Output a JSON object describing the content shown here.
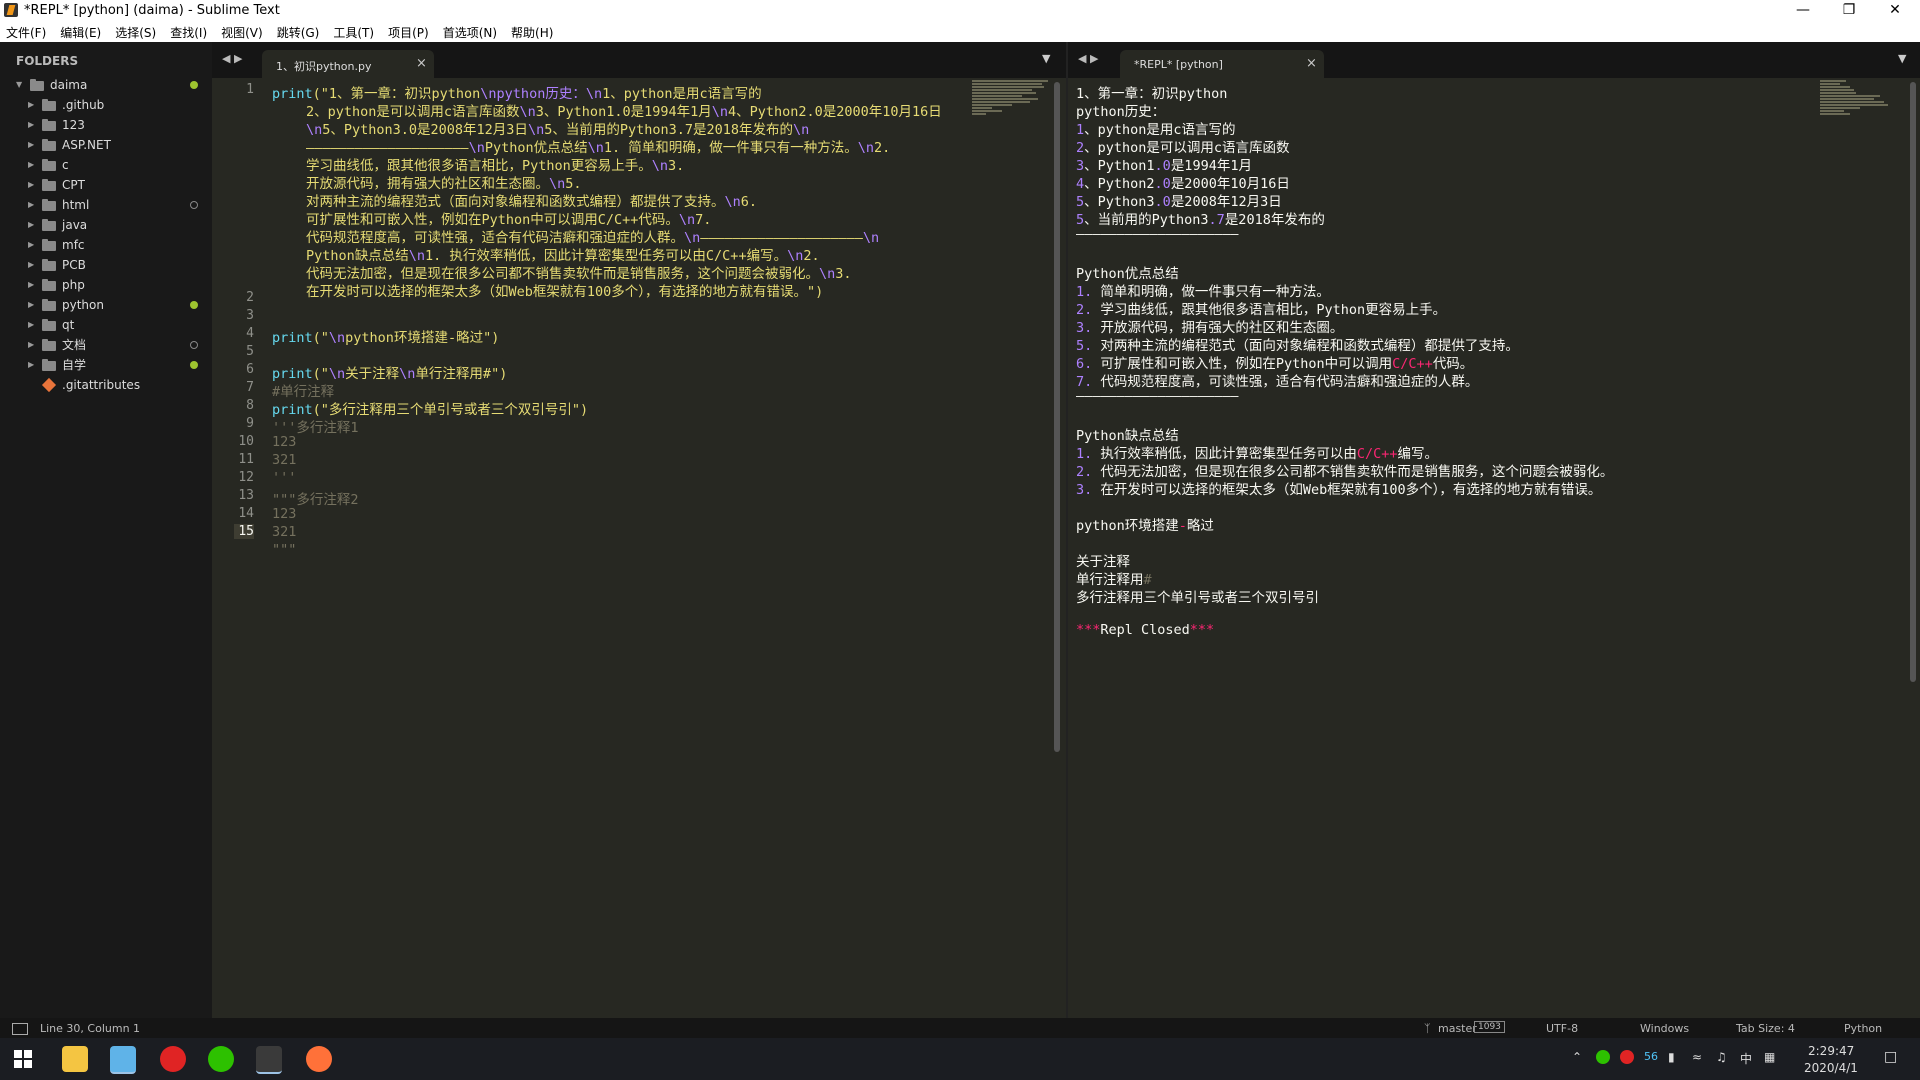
{
  "window": {
    "title": "*REPL* [python] (daima) - Sublime Text"
  },
  "menu": [
    "文件(F)",
    "编辑(E)",
    "选择(S)",
    "查找(I)",
    "视图(V)",
    "跳转(G)",
    "工具(T)",
    "项目(P)",
    "首选项(N)",
    "帮助(H)"
  ],
  "sidebar": {
    "header": "FOLDERS",
    "root": "daima",
    "items": [
      ".github",
      "123",
      "ASP.NET",
      "c",
      "CPT",
      "html",
      "java",
      "mfc",
      "PCB",
      "php",
      "python",
      "qt",
      "文档",
      "自学"
    ],
    "file": ".gitattributes"
  },
  "left_tab": {
    "label": "1、初识python.py"
  },
  "right_tab": {
    "label": "*REPL* [python]"
  },
  "line_numbers": [
    "1",
    "",
    "",
    "",
    "",
    "",
    "",
    "",
    "",
    "",
    "",
    "",
    "",
    "2",
    "3",
    "4",
    "5",
    "6",
    "7",
    "8",
    "9",
    "10",
    "11",
    "12",
    "13",
    "14",
    "15"
  ],
  "code": {
    "l1a": "print",
    "l1b": "(\"1、第一章：初识python",
    "l1c": "\\npython历史：",
    "l1d": "\\n",
    "l1e": "1、python是用c语言写的",
    "w2a": "2、python是可以调用c语言库函数",
    "w2b": "\\n",
    "w2c": "3、Python1.0是1994年1月",
    "w2d": "\\n",
    "w2e": "4、Python2.0是2000年10月16日",
    "w3a": "\\n",
    "w3b": "5、Python3.0是2008年12月3日",
    "w3c": "\\n",
    "w3d": "5、当前用的Python3.7是2018年发布的",
    "w3e": "\\n",
    "w4a": "————————————————————",
    "w4b": "\\n",
    "w4c": "Python优点总结",
    "w4d": "\\n",
    "w4e": "1. 简单和明确，做一件事只有一种方法。",
    "w4f": "\\n",
    "w4g": "2.",
    "w5a": "学习曲线低，跟其他很多语言相比，Python更容易上手。",
    "w5b": "\\n",
    "w5c": "3.",
    "w6a": "开放源代码，拥有强大的社区和生态圈。",
    "w6b": "\\n",
    "w6c": "5.",
    "w7a": "对两种主流的编程范式（面向对象编程和函数式编程）都提供了支持。",
    "w7b": "\\n",
    "w7c": "6.",
    "w8a": "可扩展性和可嵌入性，例如在Python中可以调用C/C++代码。",
    "w8b": "\\n",
    "w8c": "7.",
    "w9a": "代码规范程度高，可读性强，适合有代码洁癖和强迫症的人群。",
    "w9b": "\\n",
    "w9c": "————————————————————",
    "w9d": "\\n",
    "w10a": "Python缺点总结",
    "w10b": "\\n",
    "w10c": "1. 执行效率稍低，因此计算密集型任务可以由C/C++编写。",
    "w10d": "\\n",
    "w10e": "2.",
    "w11a": "代码无法加密，但是现在很多公司都不销售卖软件而是销售服务，这个问题会被弱化。",
    "w11b": "\\n",
    "w11c": "3.",
    "w12a": "在开发时可以选择的框架太多（如Web框架就有100多个），有选择的地方就有错误。\")",
    "l3a": "print",
    "l3b": "(\"",
    "l3c": "\\n",
    "l3d": "python环境搭建-略过\")",
    "l5a": "print",
    "l5b": "(\"",
    "l5c": "\\n",
    "l5d": "关于注释",
    "l5e": "\\n",
    "l5f": "单行注释用#\")",
    "l6": "#单行注释",
    "l7a": "print",
    "l7b": "(\"多行注释用三个单引号或者三个双引号引\")",
    "l8": "'''多行注释1",
    "l9": "123",
    "l10": "321",
    "l11": "'''",
    "l12": "\"\"\"多行注释2",
    "l13": "123",
    "l14": "321",
    "l15": "\"\"\""
  },
  "output": {
    "o1": "1、第一章：初识python",
    "o2": "python历史：",
    "o3n": "1",
    "o3": "、python是用c语言写的",
    "o4n": "2",
    "o4": "、python是可以调用c语言库函数",
    "o5n": "3",
    "o5a": "、Python1",
    "o5b": ".0",
    "o5c": "是1994年1月",
    "o6n": "4",
    "o6a": "、Python2",
    "o6b": ".0",
    "o6c": "是2000年10月16日",
    "o7n": "5",
    "o7a": "、Python3",
    "o7b": ".0",
    "o7c": "是2008年12月3日",
    "o8n": "5",
    "o8a": "、当前用的Python3",
    "o8b": ".7",
    "o8c": "是2018年发布的",
    "o9": "————————————————————",
    "o10": "Python优点总结",
    "o11n": "1.",
    "o11": " 简单和明确，做一件事只有一种方法。",
    "o12n": "2.",
    "o12": " 学习曲线低，跟其他很多语言相比，Python更容易上手。",
    "o13n": "3.",
    "o13": " 开放源代码，拥有强大的社区和生态圈。",
    "o14n": "5.",
    "o14": " 对两种主流的编程范式（面向对象编程和函数式编程）都提供了支持。",
    "o15n": "6.",
    "o15a": " 可扩展性和可嵌入性，例如在Python中可以调用",
    "o15b": "C/C++",
    "o15c": "代码。",
    "o16n": "7.",
    "o16": " 代码规范程度高，可读性强，适合有代码洁癖和强迫症的人群。",
    "o17": "————————————————————",
    "o18": "Python缺点总结",
    "o19n": "1.",
    "o19a": " 执行效率稍低，因此计算密集型任务可以由",
    "o19b": "C/C++",
    "o19c": "编写。",
    "o20n": "2.",
    "o20": " 代码无法加密，但是现在很多公司都不销售卖软件而是销售服务，这个问题会被弱化。",
    "o21n": "3.",
    "o21": " 在开发时可以选择的框架太多（如Web框架就有100多个），有选择的地方就有错误。",
    "o22a": "python环境搭建",
    "o22b": "-",
    "o22c": "略过",
    "o23": "关于注释",
    "o24a": "单行注释用",
    "o24b": "#",
    "o25": "多行注释用三个单引号或者三个双引号引",
    "o26a": "***",
    "o26b": "Repl Closed",
    "o26c": "***"
  },
  "status": {
    "position": "Line 30, Column 1",
    "branch": "master",
    "branch_count": "1093",
    "encoding": "UTF-8",
    "line_endings": "Windows",
    "tab_size": "Tab Size: 4",
    "syntax": "Python"
  },
  "taskbar": {
    "time": "2:29:47",
    "date": "2020/4/1",
    "ime": "中",
    "tray_count": "56"
  },
  "colors": {
    "keyword": "#66d9ef",
    "string": "#e6db74",
    "escape": "#ae81ff",
    "comment": "#75715e",
    "git_modified": "#9dc32f"
  }
}
